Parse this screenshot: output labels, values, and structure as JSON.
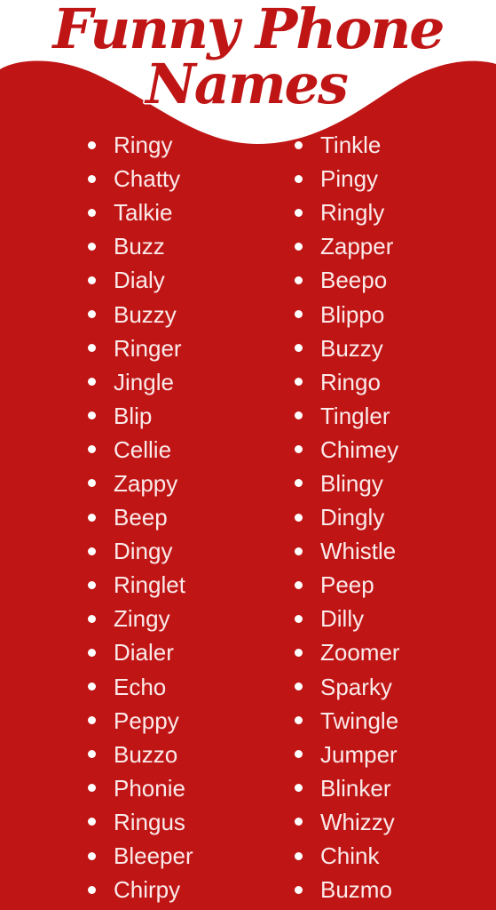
{
  "title": {
    "line1": "Funny Phone",
    "line2": "Names"
  },
  "colors": {
    "brand_red": "#c01515",
    "background_top": "#ffffff",
    "text_light": "#fbeaea"
  },
  "list": {
    "bullet_icon": "bullet-dot",
    "left_column": [
      "Ringy",
      "Chatty",
      "Talkie",
      "Buzz",
      "Dialy",
      "Buzzy",
      "Ringer",
      "Jingle",
      "Blip",
      "Cellie",
      "Zappy",
      "Beep",
      "Dingy",
      "Ringlet",
      "Zingy",
      "Dialer",
      "Echo",
      "Peppy",
      "Buzzo",
      "Phonie",
      "Ringus",
      "Bleeper",
      "Chirpy"
    ],
    "right_column": [
      "Tinkle",
      "Pingy",
      "Ringly",
      "Zapper",
      "Beepo",
      "Blippo",
      "Buzzy",
      "Ringo",
      "Tingler",
      "Chimey",
      "Blingy",
      "Dingly",
      "Whistle",
      "Peep",
      "Dilly",
      "Zoomer",
      "Sparky",
      "Twingle",
      "Jumper",
      "Blinker",
      "Whizzy",
      "Chink",
      "Buzmo"
    ]
  }
}
